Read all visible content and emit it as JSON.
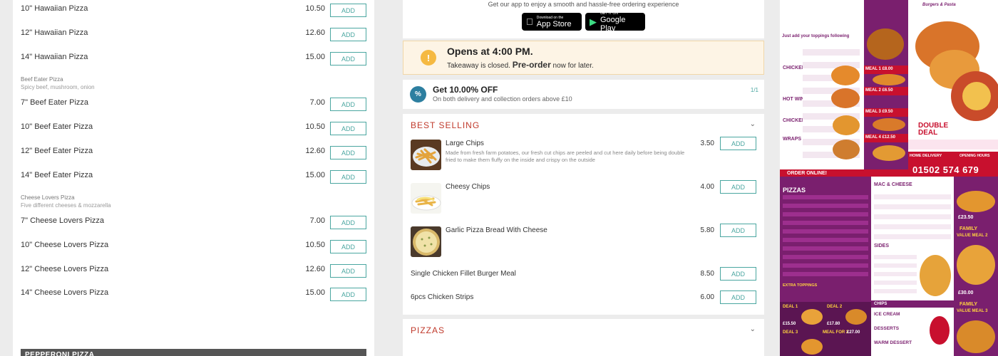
{
  "left": {
    "items": [
      {
        "name": "10\" Hawaiian Pizza",
        "price": "10.50"
      },
      {
        "name": "12\" Hawaiian Pizza",
        "price": "12.60"
      },
      {
        "name": "14\" Hawaiian Pizza",
        "price": "15.00"
      },
      {
        "name": "7\" Beef Eater Pizza",
        "price": "7.00"
      },
      {
        "name": "10\" Beef Eater Pizza",
        "price": "10.50"
      },
      {
        "name": "12\" Beef Eater Pizza",
        "price": "12.60"
      },
      {
        "name": "14\" Beef Eater Pizza",
        "price": "15.00"
      },
      {
        "name": "7\" Cheese Lovers Pizza",
        "price": "7.00"
      },
      {
        "name": "10\" Cheese Lovers Pizza",
        "price": "10.50"
      },
      {
        "name": "12\" Cheese Lovers Pizza",
        "price": "12.60"
      },
      {
        "name": "14\" Cheese Lovers Pizza",
        "price": "15.00"
      }
    ],
    "groups": [
      {
        "title": "Beef Eater Pizza",
        "desc": "Spicy beef, mushroom, onion"
      },
      {
        "title": "Cheese Lovers Pizza",
        "desc": "Five different cheeses & mozzarella"
      }
    ],
    "add_label": "ADD",
    "next_section": "PEPPERONI PIZZA"
  },
  "app": {
    "promo": "Get our app to enjoy a smooth and hassle-free ordering experience",
    "appstore_small": "Download on the",
    "appstore_big": "App Store",
    "google_small": "GET IT ON",
    "google_big": "Google Play"
  },
  "status": {
    "icon": "!",
    "opens": "Opens at 4:00 PM.",
    "closed_prefix": "Takeaway is closed.",
    "preorder": "Pre-order",
    "closed_suffix": "now for later."
  },
  "offer": {
    "badge": "%",
    "title": "Get 10.00% OFF",
    "subtitle": "On both delivery and collection orders above £10",
    "count": "1/1"
  },
  "best_selling": {
    "title": "BEST SELLING",
    "items": [
      {
        "name": "Large Chips",
        "price": "3.50",
        "desc": "Made from fresh farm potatoes, our fresh cut chips are peeled and cut here daily before being double fried to make them fluffy on the inside and crispy on the outside"
      },
      {
        "name": "Cheesy Chips",
        "price": "4.00"
      },
      {
        "name": "Garlic Pizza Bread With Cheese",
        "price": "5.80"
      },
      {
        "name": "Single Chicken Fillet Burger Meal",
        "price": "8.50"
      },
      {
        "name": "6pcs Chicken Strips",
        "price": "6.00"
      }
    ]
  },
  "pizzas": {
    "title": "PIZZAS"
  },
  "chevron": "⌄",
  "poster": {
    "phone": "01502 574 679",
    "double_deal": "DOUBLE DEAL",
    "home_delivery": "HOME DELIVERY",
    "pizzas": "PIZZAS",
    "sides": "SIDES",
    "mac_cheese": "MAC & CHEESE",
    "family": "FAMILY",
    "value_meal_2": "VALUE MEAL 2",
    "value_meal_3": "VALUE MEAL 3",
    "deal_1": "DEAL 1",
    "deal_2": "DEAL 2",
    "deal_3": "DEAL 3",
    "meal_for_2": "MEAL FOR 2",
    "ice_cream": "ICE CREAM",
    "desserts": "DESSERTS",
    "chicken": "CHICKEN",
    "hot_wings": "HOT WINGS",
    "chicken_strips": "CHICKEN STRIPS",
    "wraps": "WRAPS",
    "meal_1": "MEAL 1",
    "meal_2": "MEAL 2",
    "meal_3": "MEAL 3",
    "meal_4": "MEAL 4",
    "p800": "£8.00",
    "p650": "£6.50",
    "p950": "£9.50",
    "p1250": "£12.50",
    "p2350": "£23.50",
    "p3000": "£30.00",
    "p1550": "£15.50",
    "p1780": "£17.80",
    "p2700": "£27.00",
    "order_online": "ORDER ONLINE!",
    "toppings": "Just add your toppings following",
    "extra_toppings": "EXTRA TOPPINGS",
    "chips": "CHIPS",
    "warm_dessert": "WARM DESSERT",
    "burgers": "Burgers & Pasta",
    "opening_hours": "OPENING HOURS"
  }
}
